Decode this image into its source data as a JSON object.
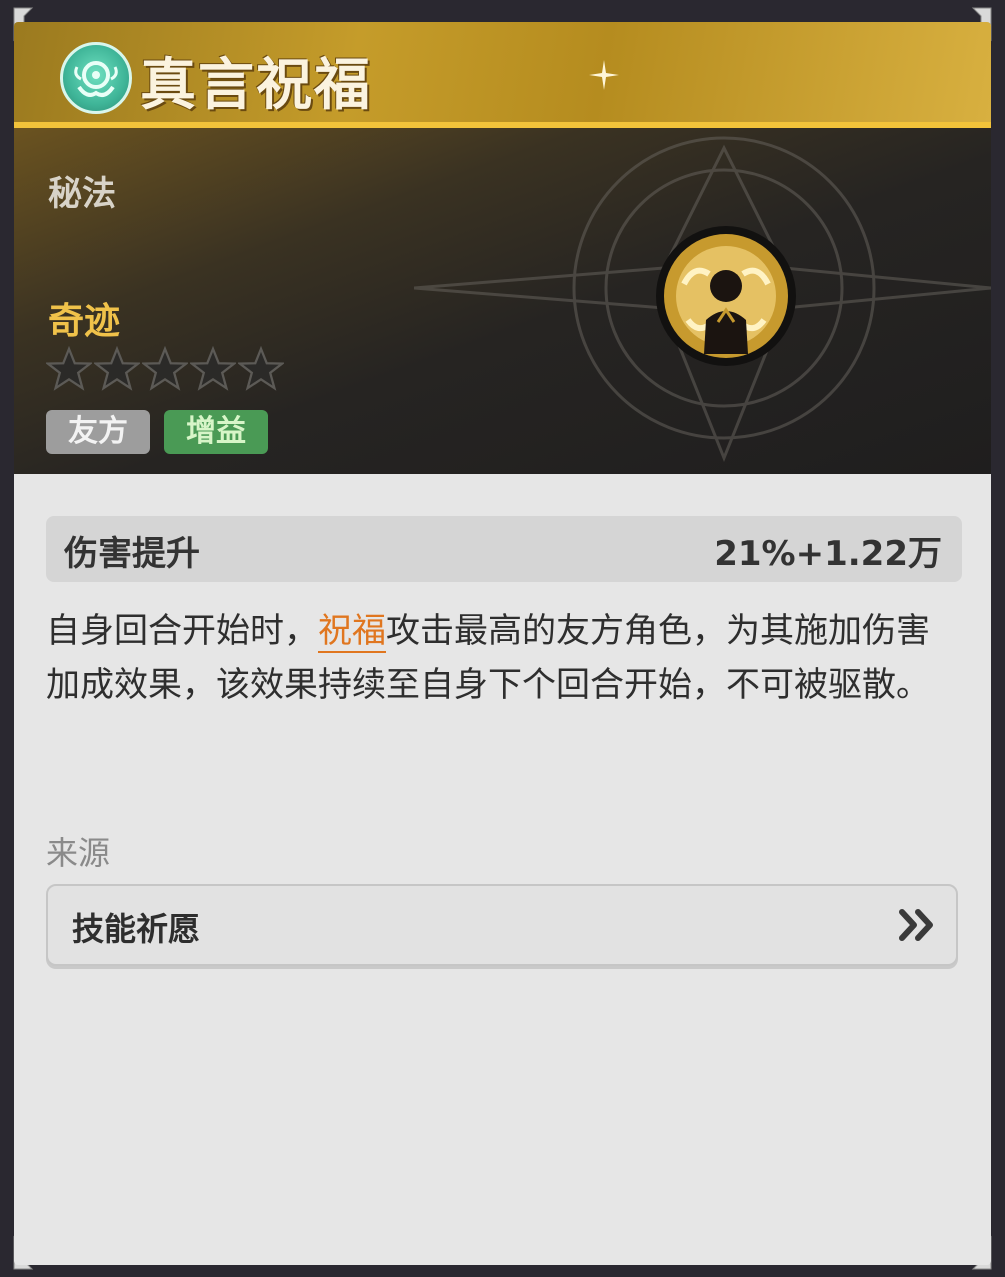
{
  "header": {
    "title": "真言祝福",
    "emblem_icon": "teal-swirl-emblem-icon"
  },
  "hero": {
    "category": "秘法",
    "name": "奇迹",
    "stars": {
      "filled": 0,
      "total": 5
    },
    "tags": [
      {
        "label": "友方",
        "color": "#9d9d9d"
      },
      {
        "label": "增益",
        "color": "#4a9a55"
      }
    ],
    "portrait_icon": "praying-figure-icon"
  },
  "stat": {
    "label": "伤害提升",
    "value": "21%+1.22万"
  },
  "description": {
    "part1": "自身回合开始时，",
    "highlight": "祝福",
    "part2": "攻击最高的友方角色，为其施加伤害加成效果，该效果持续至自身下个回合开始，不可被驱散。"
  },
  "source": {
    "label": "来源",
    "item": "技能祈愿",
    "arrow_icon": "double-chevron-right-icon"
  },
  "colors": {
    "accent_gold": "#f2c33a",
    "highlight_orange": "#e0761f"
  }
}
